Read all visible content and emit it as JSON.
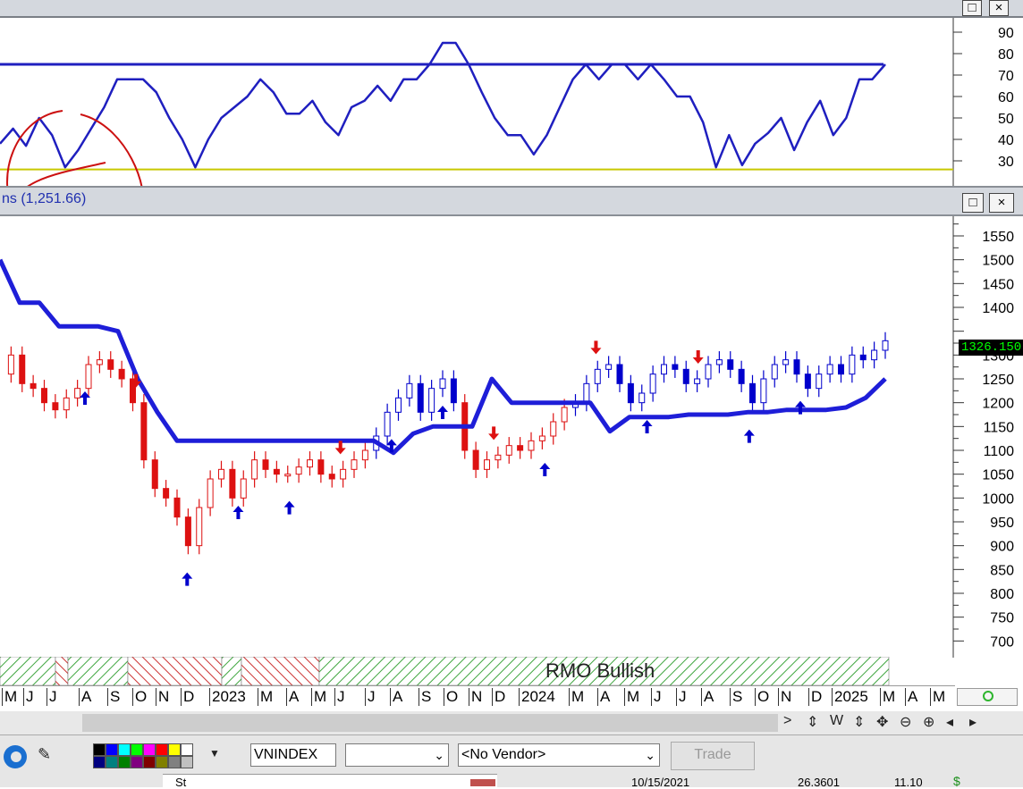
{
  "rsi_panel": {
    "y_ticks": [
      "90",
      "80",
      "70",
      "60",
      "50",
      "40",
      "30"
    ],
    "close_button": "×",
    "maximize_button": "□"
  },
  "price_panel": {
    "legend": "ns (1,251.66)",
    "y_ticks": [
      "1550",
      "1500",
      "1450",
      "1400",
      "1300",
      "1250",
      "1200",
      "1150",
      "1100",
      "1050",
      "1000",
      "950",
      "900",
      "850",
      "800",
      "750",
      "700"
    ],
    "last_price": "1326.150",
    "close_button": "×",
    "maximize_button": "□"
  },
  "rmo_band": {
    "label": "RMO Bullish"
  },
  "months": [
    "M",
    "J",
    "J",
    "A",
    "S",
    "O",
    "N",
    "D",
    "2023",
    "M",
    "A",
    "M",
    "J",
    "J",
    "A",
    "S",
    "O",
    "N",
    "D",
    "2024",
    "M",
    "A",
    "M",
    "J",
    "J",
    "A",
    "S",
    "O",
    "N",
    "D",
    "2025",
    "M",
    "A",
    "M"
  ],
  "toolbar": {
    "nav_icons": [
      ">",
      "⇕",
      "W",
      "⇕",
      "✥",
      "⊖",
      "⊕",
      "◂",
      "▸"
    ],
    "symbol": "VNINDEX",
    "vendor": "<No Vendor>",
    "trade_label": "Trade"
  },
  "statusbar": {
    "fragment1": "St",
    "date": "10/15/2021",
    "num1": "26.3601",
    "num2": "11.10",
    "dollar": "$"
  },
  "colors": {
    "series": "#1f1fbf",
    "up": "#0000cc",
    "down": "#dd1111",
    "stop": "#1e1ed8",
    "bull": "#3fa63f",
    "bear": "#cc3333"
  },
  "chart_data": [
    {
      "type": "line",
      "title": "",
      "xlabel": "",
      "ylabel": "",
      "ylim": [
        20,
        95
      ],
      "series": [
        {
          "values": [
            38,
            45,
            37,
            50,
            42,
            27,
            35,
            45,
            55,
            68,
            68,
            68,
            62,
            50,
            40,
            27,
            40,
            50,
            55,
            60,
            68,
            62,
            52,
            52,
            58,
            48,
            42,
            55,
            58,
            65,
            58,
            68,
            68,
            75,
            85,
            85,
            75,
            62,
            50,
            42,
            42,
            33,
            42,
            55,
            68,
            75,
            68,
            75,
            75,
            68,
            75,
            68,
            60,
            60,
            48,
            27,
            42,
            28,
            38,
            43,
            50,
            35,
            48,
            58,
            42,
            50,
            68,
            68,
            75
          ]
        }
      ],
      "hlines": [
        75,
        26
      ]
    },
    {
      "type": "line",
      "title": "",
      "xlabel": "",
      "ylabel": "",
      "ylim": [
        680,
        1580
      ],
      "series": [
        {
          "values": [
            1260,
            1300,
            1240,
            1230,
            1200,
            1185,
            1210,
            1230,
            1280,
            1290,
            1270,
            1250,
            1200,
            1080,
            1020,
            1000,
            960,
            900,
            980,
            1040,
            1060,
            1000,
            1040,
            1080,
            1060,
            1050,
            1050,
            1065,
            1080,
            1050,
            1040,
            1060,
            1080,
            1100,
            1130,
            1180,
            1210,
            1240,
            1180,
            1230,
            1250,
            1200,
            1100,
            1060,
            1080,
            1090,
            1110,
            1100,
            1120,
            1130,
            1160,
            1190,
            1200,
            1240,
            1270,
            1280,
            1240,
            1200,
            1220,
            1260,
            1280,
            1270,
            1240,
            1250,
            1280,
            1290,
            1270,
            1240,
            1200,
            1250,
            1280,
            1290,
            1260,
            1230,
            1260,
            1280,
            1260,
            1300,
            1290,
            1310,
            1330
          ]
        },
        {
          "values": [
            1500,
            1410,
            1410,
            1360,
            1360,
            1360,
            1350,
            1250,
            1180,
            1120,
            1120,
            1120,
            1120,
            1120,
            1120,
            1120,
            1120,
            1120,
            1120,
            1120,
            1095,
            1135,
            1150,
            1150,
            1150,
            1250,
            1200,
            1200,
            1200,
            1200,
            1200,
            1140,
            1170,
            1170,
            1170,
            1175,
            1175,
            1175,
            1180,
            1180,
            1185,
            1185,
            1185,
            1190,
            1210,
            1250
          ]
        }
      ],
      "signals": [
        "up",
        "down",
        "up",
        "up",
        "up",
        "down",
        "up",
        "up",
        "down",
        "up",
        "down",
        "up",
        "down",
        "up",
        "up"
      ]
    }
  ]
}
